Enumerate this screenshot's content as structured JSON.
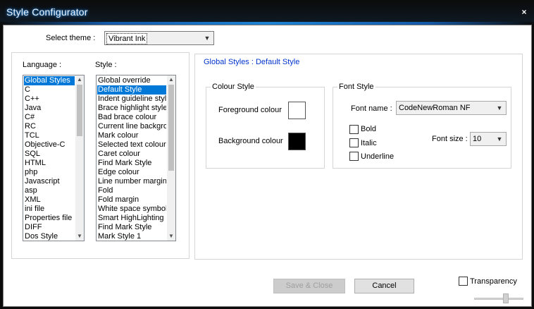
{
  "window": {
    "title": "Style Configurator",
    "close_glyph": "×"
  },
  "theme": {
    "label": "Select theme :",
    "value": "Vibrant Ink"
  },
  "language": {
    "label": "Language :",
    "items": [
      "Global Styles",
      "C",
      "C++",
      "Java",
      "C#",
      "RC",
      "TCL",
      "Objective-C",
      "SQL",
      "HTML",
      "php",
      "Javascript",
      "asp",
      "XML",
      "ini file",
      "Properties file",
      "DIFF",
      "Dos Style"
    ],
    "selected_index": 0
  },
  "style": {
    "label": "Style :",
    "items": [
      "Global override",
      "Default Style",
      "Indent guideline style",
      "Brace highlight style",
      "Bad brace colour",
      "Current line background colour",
      "Mark colour",
      "Selected text colour",
      "Caret colour",
      "Find Mark Style",
      "Edge colour",
      "Line number margin",
      "Fold",
      "Fold margin",
      "White space symbol",
      "Smart HighLighting",
      "Find Mark Style",
      "Mark Style 1"
    ],
    "selected_index": 1
  },
  "header": {
    "text": "Global Styles : Default Style"
  },
  "colour_style": {
    "title": "Colour Style",
    "foreground_label": "Foreground colour",
    "background_label": "Background colour",
    "foreground_color": "#ffffff",
    "background_color": "#000000"
  },
  "font_style": {
    "title": "Font Style",
    "font_name_label": "Font name :",
    "font_name_value": "CodeNewRoman NF",
    "bold_label": "Bold",
    "italic_label": "Italic",
    "underline_label": "Underline",
    "bold": false,
    "italic": false,
    "underline": false,
    "font_size_label": "Font size :",
    "font_size_value": "10"
  },
  "buttons": {
    "save_close": "Save & Close",
    "cancel": "Cancel"
  },
  "transparency": {
    "label": "Transparency",
    "checked": false
  }
}
